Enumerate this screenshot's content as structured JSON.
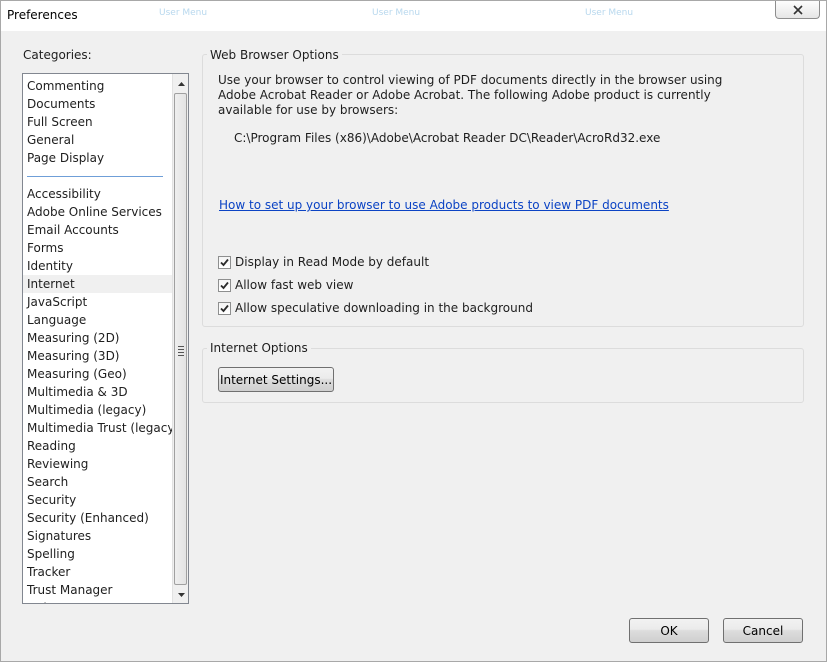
{
  "window": {
    "title": "Preferences"
  },
  "ghost_tabs": [
    "User Menu",
    "User Menu",
    "User Menu"
  ],
  "categories": {
    "label": "Categories:",
    "group1": [
      "Commenting",
      "Documents",
      "Full Screen",
      "General",
      "Page Display"
    ],
    "group2": [
      "Accessibility",
      "Adobe Online Services",
      "Email Accounts",
      "Forms",
      "Identity",
      "Internet",
      "JavaScript",
      "Language",
      "Measuring (2D)",
      "Measuring (3D)",
      "Measuring (Geo)",
      "Multimedia & 3D",
      "Multimedia (legacy)",
      "Multimedia Trust (legacy)",
      "Reading",
      "Reviewing",
      "Search",
      "Security",
      "Security (Enhanced)",
      "Signatures",
      "Spelling",
      "Tracker",
      "Trust Manager",
      "Units"
    ],
    "selected": "Internet"
  },
  "web_browser": {
    "title": "Web Browser Options",
    "description": "Use your browser to control viewing of PDF documents directly in the browser using Adobe Acrobat Reader or Adobe Acrobat. The following Adobe product is currently available for use by browsers:",
    "product_path": "C:\\Program Files (x86)\\Adobe\\Acrobat Reader DC\\Reader\\AcroRd32.exe",
    "help_link": "How to set up your browser to use Adobe products to view PDF documents",
    "checkboxes": [
      {
        "label": "Display in Read Mode by default",
        "checked": true
      },
      {
        "label": "Allow fast web view",
        "checked": true
      },
      {
        "label": "Allow speculative downloading in the background",
        "checked": true
      }
    ]
  },
  "internet_options": {
    "title": "Internet Options",
    "settings_button": "Internet Settings..."
  },
  "footer": {
    "ok": "OK",
    "cancel": "Cancel"
  }
}
